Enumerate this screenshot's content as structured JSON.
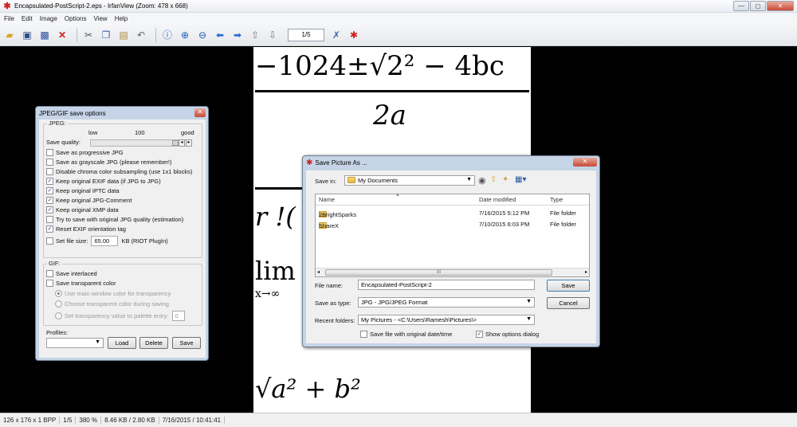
{
  "window": {
    "title": "Encapsulated-PostScript-2.eps - IrfanView (Zoom: 478 x 668)",
    "controls": [
      "—",
      "◻",
      "✕"
    ]
  },
  "menu": [
    "File",
    "Edit",
    "Image",
    "Options",
    "View",
    "Help"
  ],
  "toolbar": {
    "page_indicator": "1/5",
    "icons": [
      "open-icon",
      "slideshow-icon",
      "save-icon",
      "delete-icon",
      "cut-icon",
      "copy-icon",
      "paste-icon",
      "undo-icon",
      "info-icon",
      "zoom-in-icon",
      "zoom-out-icon",
      "previous-icon",
      "next-icon",
      "first-page-icon",
      "next-page-icon",
      "settings-icon",
      "exit-icon"
    ]
  },
  "image_content": {
    "formula1_numerator": "−1024±√2² − 4bc",
    "formula1_denominator": "2a",
    "fragment_r": "r !(",
    "fragment_lim": "lim",
    "fragment_lim_sub": "x→∞",
    "fragment_sqrt": "√a² + b²"
  },
  "statusbar": {
    "dims": "126 x 176 x 1 BPP",
    "page": "1/5",
    "zoom": "380 %",
    "size": "8.46 KB / 2.80 KB",
    "datetime": "7/16/2015 / 10:41:41"
  },
  "jpeg_dialog": {
    "title": "JPEG/GIF save options",
    "jpeg_group": "JPEG:",
    "quality_low": "low",
    "quality_value": "100",
    "quality_good": "good",
    "quality_label": "Save quality:",
    "options": [
      {
        "label": "Save as progressive JPG",
        "checked": false
      },
      {
        "label": "Save as grayscale JPG (please remember!)",
        "checked": false
      },
      {
        "label": "Disable chroma color subsampling (use 1x1 blocks)",
        "checked": false
      },
      {
        "label": "Keep original EXIF data (if JPG to JPG)",
        "checked": true
      },
      {
        "label": "Keep original IPTC data",
        "checked": true
      },
      {
        "label": "Keep original JPG-Comment",
        "checked": true
      },
      {
        "label": "Keep original XMP data",
        "checked": true
      },
      {
        "label": "Try to save with original JPG quality (estimation)",
        "checked": false
      },
      {
        "label": "Reset EXIF orientation tag",
        "checked": true
      }
    ],
    "set_file_size_label": "Set file size:",
    "file_size_value": "65.00",
    "file_size_unit": "KB (RIOT PlugIn)",
    "gif_group": "GIF:",
    "save_interlaced": "Save interlaced",
    "save_transparent": "Save transparent color",
    "transparency_options": [
      "Use main window color for transparency",
      "Choose transparent color during saving",
      "Set transparency value to palette entry:"
    ],
    "palette_entry_value": "0",
    "profiles_label": "Profiles:",
    "load_button": "Load",
    "delete_button": "Delete",
    "save_button": "Save"
  },
  "save_dialog": {
    "title": "Save Picture As ...",
    "save_in_label": "Save in:",
    "save_in_value": "My Documents",
    "columns": [
      "Name",
      "Date modified",
      "Type"
    ],
    "files": [
      {
        "name": "2BrightSparks",
        "date": "7/16/2015 5:12 PM",
        "type": "File folder"
      },
      {
        "name": "ShareX",
        "date": "7/10/2015 6:03 PM",
        "type": "File folder"
      }
    ],
    "scroll_grip": "III",
    "file_name_label": "File name:",
    "file_name_value": "Encapsulated-PostScript-2",
    "save_as_type_label": "Save as type:",
    "save_as_type_value": "JPG - JPG/JPEG Format",
    "recent_folders_label": "Recent folders:",
    "recent_folders_value": "My Pictures  -  <C:\\Users\\Ramesh\\Pictures\\>",
    "save_button": "Save",
    "cancel_button": "Cancel",
    "keep_date_label": "Save file with original date/time",
    "keep_date_checked": false,
    "show_options_label": "Show options dialog",
    "show_options_checked": true
  },
  "colors": {
    "background": "#000000",
    "dialog_frame": "#c5d4e6",
    "close_red": "#c84a36"
  }
}
